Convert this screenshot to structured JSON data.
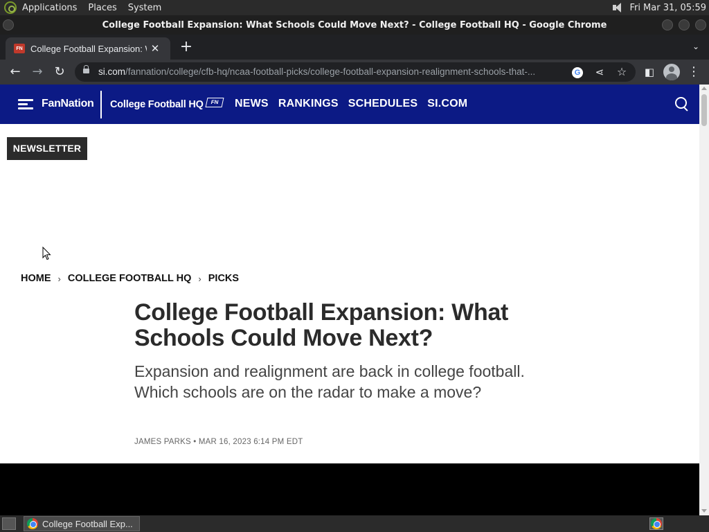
{
  "system_panel": {
    "menus": [
      "Applications",
      "Places",
      "System"
    ],
    "clock": "Fri Mar 31, 05:59"
  },
  "window": {
    "title": "College Football Expansion: What Schools Could Move Next? - College Football HQ - Google Chrome"
  },
  "browser": {
    "tab_title": "College Football Expansion: W",
    "favicon_text": "FN",
    "url_host": "si.com",
    "url_path": "/fannation/college/cfb-hq/ncaa-football-picks/college-football-expansion-realignment-schools-that-..."
  },
  "site": {
    "brand": "FanNation",
    "section_brand": "College Football HQ",
    "section_badge": "FN",
    "nav": [
      "NEWS",
      "RANKINGS",
      "SCHEDULES",
      "SI.COM"
    ],
    "newsletter_label": "NEWSLETTER",
    "colors": {
      "nav_bg": "#0c1a85",
      "newsletter_bg": "#2b2b2b"
    }
  },
  "article": {
    "breadcrumb": [
      "HOME",
      "COLLEGE FOOTBALL HQ",
      "PICKS"
    ],
    "headline": "College Football Expansion: What Schools Could Move Next?",
    "dek": "Expansion and realignment are back in college football. Which schools are on the radar to make a move?",
    "byline": "JAMES PARKS • MAR 16, 2023 6:14 PM EDT"
  },
  "taskbar": {
    "task_label": "College Football Exp..."
  }
}
